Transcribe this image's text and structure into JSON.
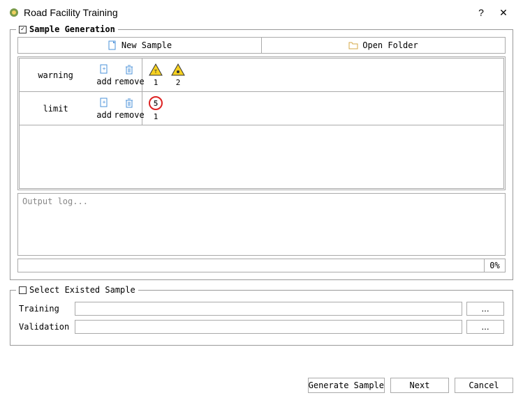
{
  "title": "Road Facility Training",
  "sample_generation": {
    "legend": "Sample Generation",
    "checked": true,
    "new_sample": "New Sample",
    "open_folder": "Open Folder",
    "add_label": "add",
    "remove_label": "remove",
    "rows": [
      {
        "name": "warning",
        "thumbs": [
          "1",
          "2"
        ]
      },
      {
        "name": "limit",
        "thumbs": [
          "1"
        ]
      }
    ],
    "output_log": "Output log...",
    "progress": "0%"
  },
  "select_existed": {
    "legend": "Select Existed Sample",
    "checked": false,
    "training_label": "Training",
    "validation_label": "Validation",
    "training_value": "",
    "validation_value": "",
    "browse": "..."
  },
  "footer": {
    "generate": "Generate Sample",
    "next": "Next",
    "cancel": "Cancel"
  }
}
